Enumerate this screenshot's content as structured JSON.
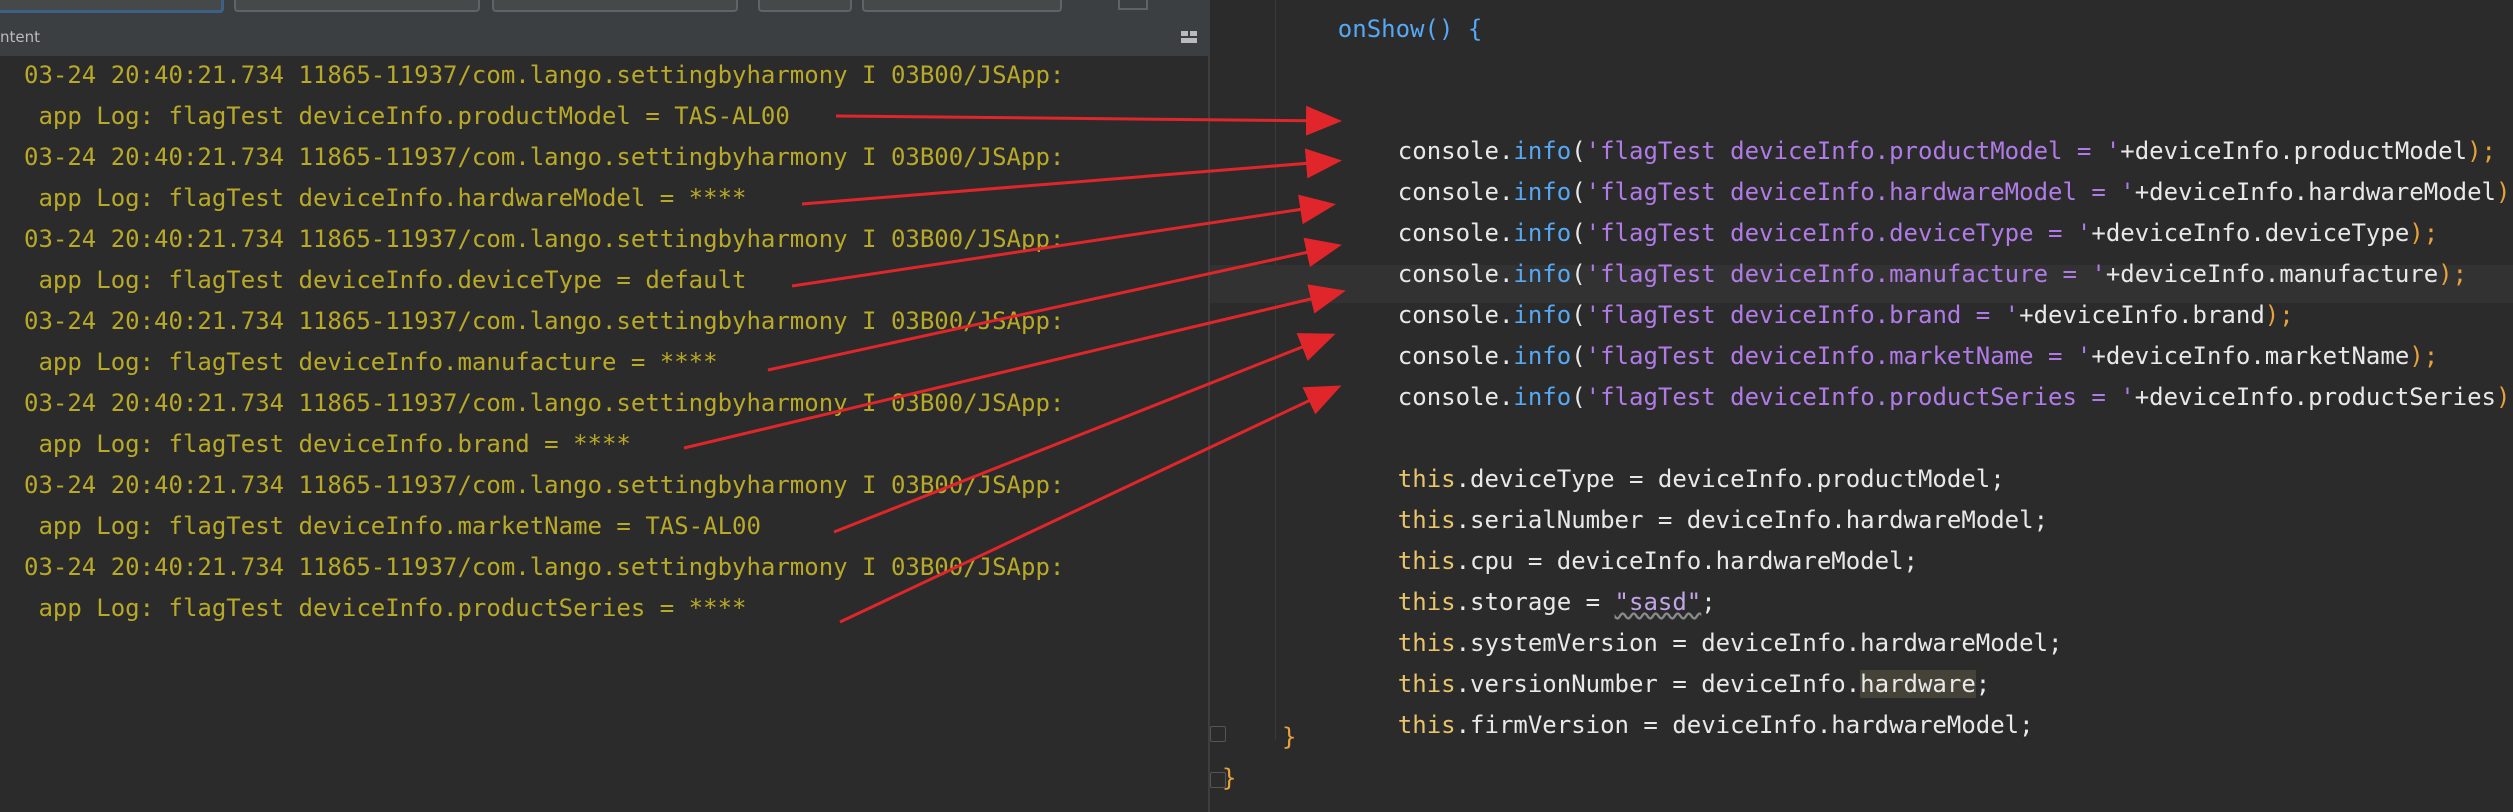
{
  "log_panel": {
    "tab_label": "ntent",
    "lines": [
      "03-24 20:40:21.734 11865-11937/com.lango.settingbyharmony I 03B00/JSApp:",
      " app Log: flagTest deviceInfo.productModel = TAS-AL00",
      "03-24 20:40:21.734 11865-11937/com.lango.settingbyharmony I 03B00/JSApp:",
      " app Log: flagTest deviceInfo.hardwareModel = ****",
      "03-24 20:40:21.734 11865-11937/com.lango.settingbyharmony I 03B00/JSApp:",
      " app Log: flagTest deviceInfo.deviceType = default",
      "03-24 20:40:21.734 11865-11937/com.lango.settingbyharmony I 03B00/JSApp:",
      " app Log: flagTest deviceInfo.manufacture = ****",
      "03-24 20:40:21.734 11865-11937/com.lango.settingbyharmony I 03B00/JSApp:",
      " app Log: flagTest deviceInfo.brand = ****",
      "03-24 20:40:21.734 11865-11937/com.lango.settingbyharmony I 03B00/JSApp:",
      " app Log: flagTest deviceInfo.marketName = TAS-AL00",
      "03-24 20:40:21.734 11865-11937/com.lango.settingbyharmony I 03B00/JSApp:",
      " app Log: flagTest deviceInfo.productSeries = ****"
    ]
  },
  "editor": {
    "header_line": "onShow() {",
    "console_lines": [
      {
        "obj": "console",
        "method": "info",
        "str": "'flagTest deviceInfo.productModel = '",
        "expr": "+deviceInfo.productModel",
        "end": ");"
      },
      {
        "obj": "console",
        "method": "info",
        "str": "'flagTest deviceInfo.hardwareModel = '",
        "expr": "+deviceInfo.hardwareModel",
        "end": ");"
      },
      {
        "obj": "console",
        "method": "info",
        "str": "'flagTest deviceInfo.deviceType = '",
        "expr": "+deviceInfo.deviceType",
        "end": ");"
      },
      {
        "obj": "console",
        "method": "info",
        "str": "'flagTest deviceInfo.manufacture = '",
        "expr": "+deviceInfo.manufacture",
        "end": ");"
      },
      {
        "obj": "console",
        "method": "info",
        "str": "'flagTest deviceInfo.brand = '",
        "expr": "+deviceInfo.brand",
        "end": ");"
      },
      {
        "obj": "console",
        "method": "info",
        "str": "'flagTest deviceInfo.marketName = '",
        "expr": "+deviceInfo.marketName",
        "end": ");"
      },
      {
        "obj": "console",
        "method": "info",
        "str": "'flagTest deviceInfo.productSeries = '",
        "expr": "+deviceInfo.productSeries",
        "end": ");"
      }
    ],
    "assign_lines": [
      {
        "kw": "this",
        "prop": ".deviceType = deviceInfo.productModel;"
      },
      {
        "kw": "this",
        "prop": ".serialNumber = deviceInfo.hardwareModel;"
      },
      {
        "kw": "this",
        "prop": ".cpu = deviceInfo.hardwareModel;"
      },
      {
        "kw": "this",
        "prop": ".storage = ",
        "str": "\"sasd\"",
        "end": ";"
      },
      {
        "kw": "this",
        "prop": ".systemVersion = deviceInfo.hardwareModel;"
      },
      {
        "kw": "this",
        "prop": ".versionNumber = deviceInfo.",
        "hl": "hardware",
        "end": ";"
      },
      {
        "kw": "this",
        "prop": ".firmVersion = deviceInfo.hardwareModel;"
      }
    ],
    "close_inner": "}",
    "close_outer": "}"
  },
  "colors": {
    "log_text": "#b8a928",
    "arrow": "#e0262a",
    "keyword": "#e8c46a",
    "method": "#56a8f5",
    "string": "#b07be6"
  },
  "icons": [
    "layout-icon",
    "fold-marker-icon"
  ]
}
